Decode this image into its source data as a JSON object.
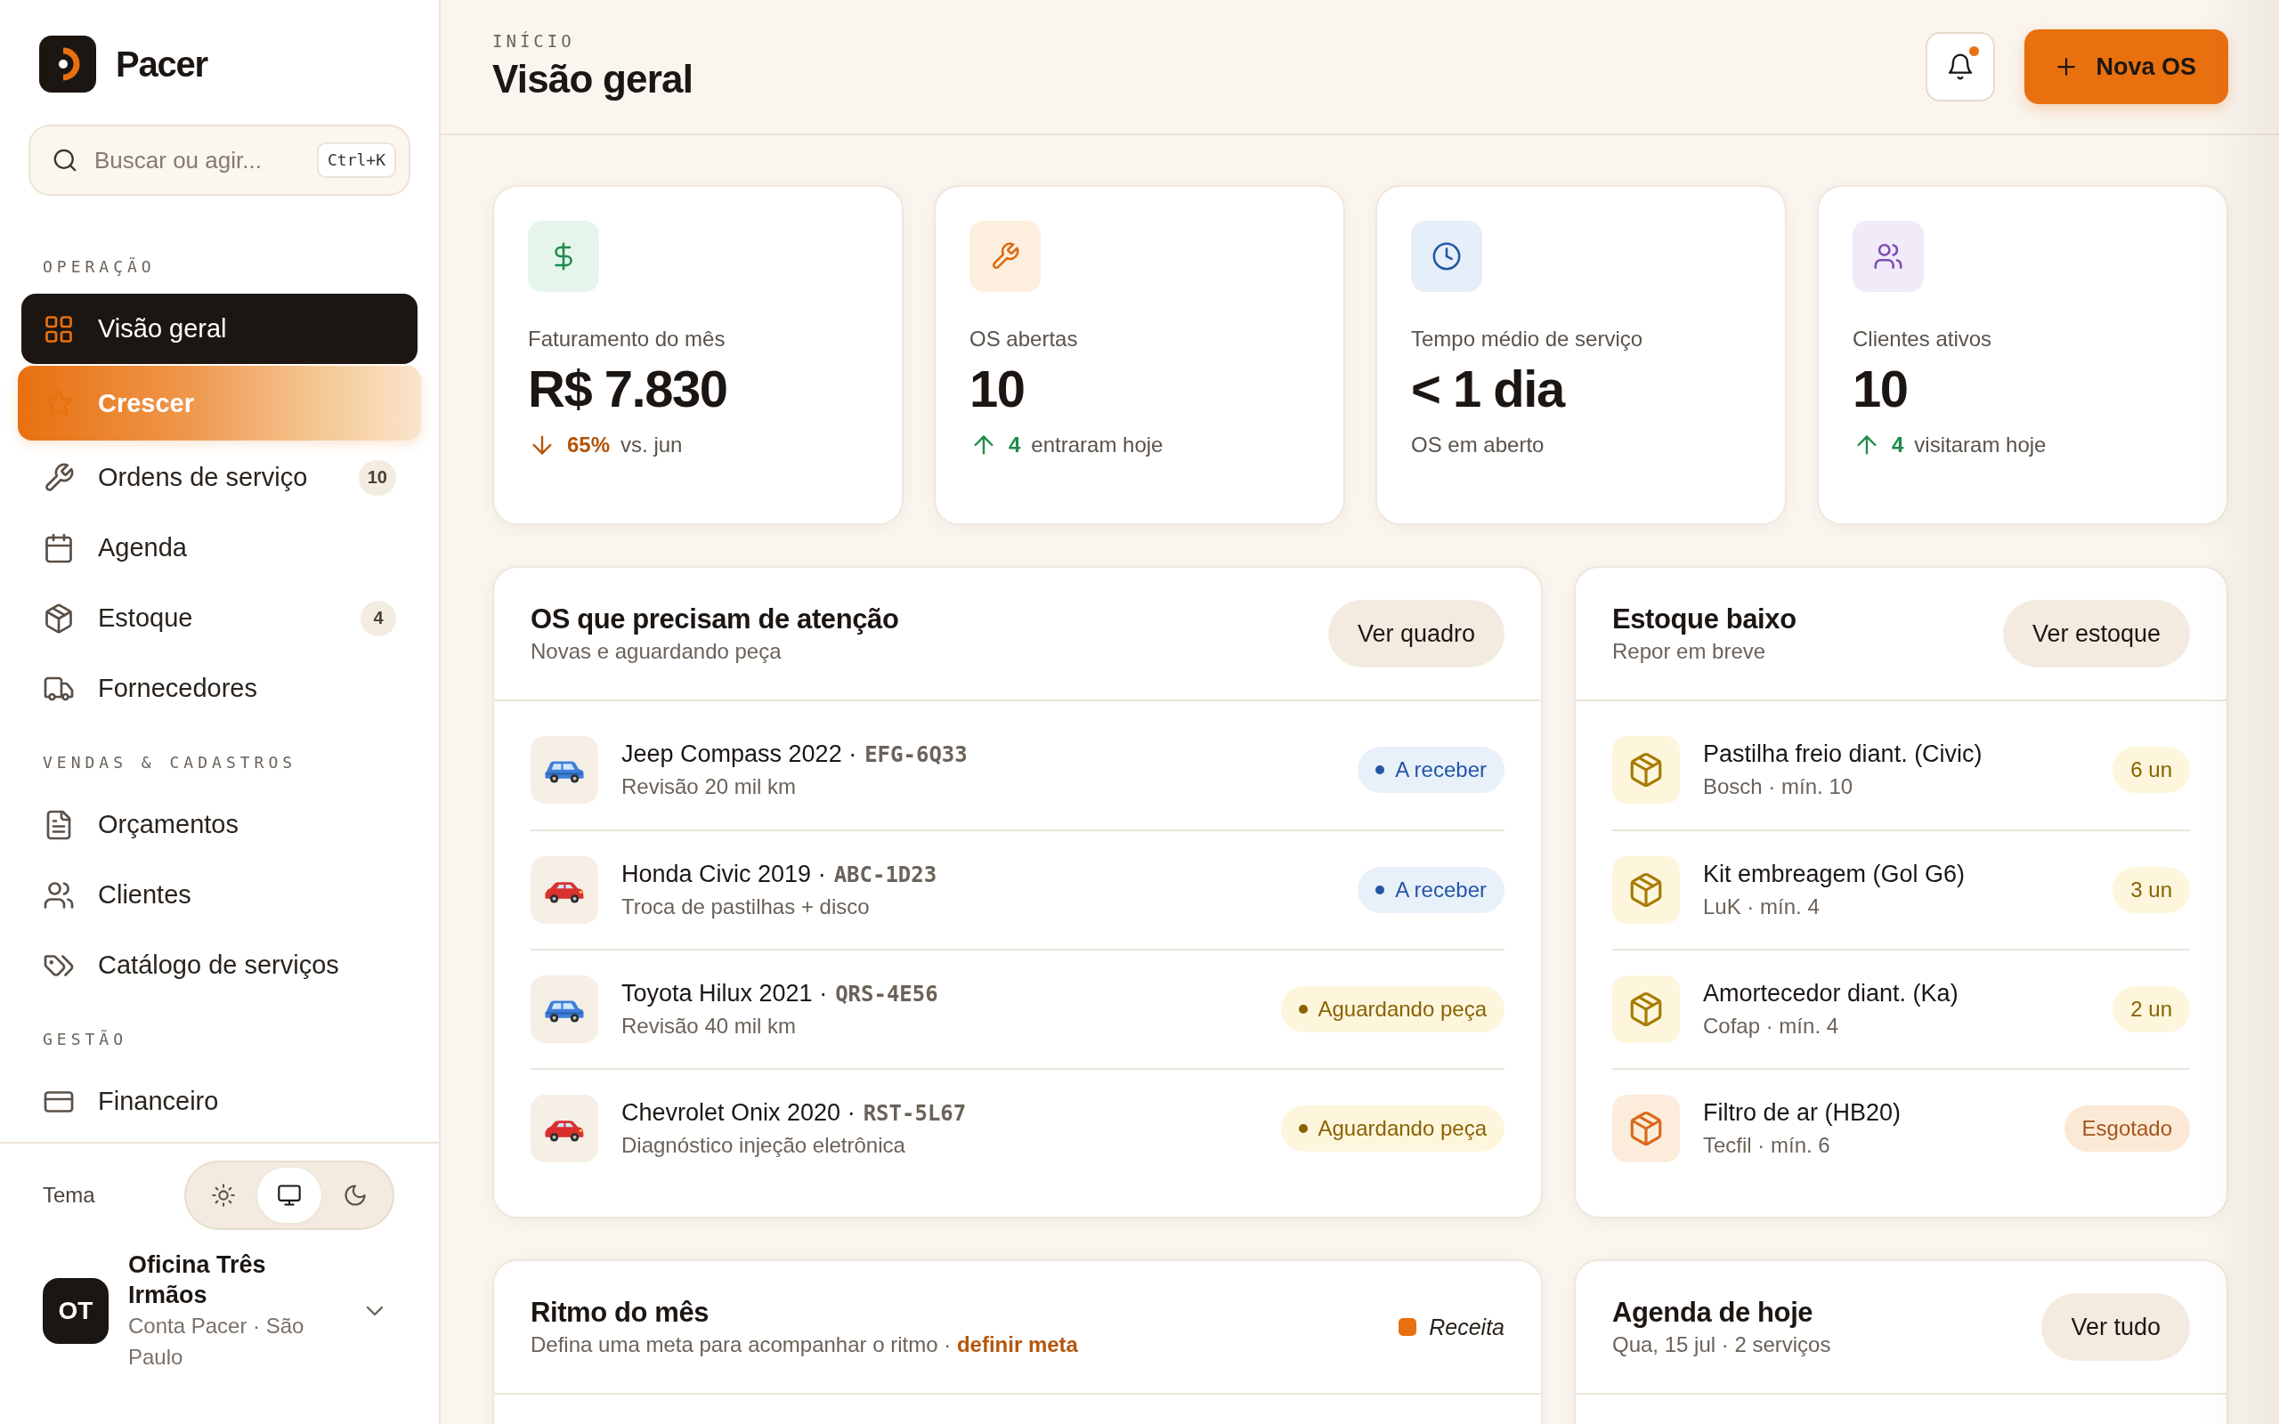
{
  "sidebar": {
    "brand": "Pacer",
    "search": {
      "placeholder": "Buscar ou agir...",
      "shortcut": "Ctrl+K"
    },
    "sections": [
      {
        "title": "OPERAÇÃO",
        "items": [
          {
            "kind": "overview",
            "label": "Visão geral",
            "selected": true,
            "featured": false
          },
          {
            "kind": "growth",
            "label": "Crescer",
            "selected": false,
            "featured": true
          },
          {
            "kind": "orders",
            "label": "Ordens de serviço",
            "selected": false,
            "featured": false,
            "count": "10"
          },
          {
            "kind": "calendar",
            "label": "Agenda",
            "selected": false,
            "featured": false
          },
          {
            "kind": "stock",
            "label": "Estoque",
            "selected": false,
            "featured": false,
            "count": "4"
          },
          {
            "kind": "suppliers",
            "label": "Fornecedores",
            "selected": false,
            "featured": false
          }
        ]
      },
      {
        "title": "VENDAS & CADASTROS",
        "items": [
          {
            "kind": "quotes",
            "label": "Orçamentos",
            "selected": false,
            "featured": false
          },
          {
            "kind": "clients",
            "label": "Clientes",
            "selected": false,
            "featured": false
          },
          {
            "kind": "catalog",
            "label": "Catálogo de serviços",
            "selected": false,
            "featured": false
          }
        ]
      },
      {
        "title": "GESTÃO",
        "items": [
          {
            "kind": "finance",
            "label": "Financeiro",
            "selected": false,
            "featured": false
          }
        ]
      }
    ],
    "theme": {
      "label": "Tema",
      "options": [
        {
          "kind": "light",
          "selected": false
        },
        {
          "kind": "system",
          "selected": true
        },
        {
          "kind": "dark",
          "selected": false
        }
      ]
    },
    "account": {
      "initials": "OT",
      "name": "Oficina Três Irmãos",
      "details": "Conta Pacer · São Paulo"
    }
  },
  "header": {
    "breadcrumb": "INÍCIO",
    "title": "Visão geral",
    "notifications": {
      "unread": true
    },
    "primary_action": "Nova OS"
  },
  "stats": [
    {
      "kind": "revenue",
      "label": "Faturamento do mês",
      "value": "R$ 7.830",
      "footer": {
        "kind": "down",
        "delta": "65%",
        "note": "vs. jun"
      }
    },
    {
      "kind": "orders",
      "label": "OS abertas",
      "value": "10",
      "footer": {
        "kind": "up",
        "delta": "4",
        "note": "entraram hoje"
      }
    },
    {
      "kind": "time",
      "label": "Tempo médio de serviço",
      "value": "< 1 dia",
      "footer": {
        "kind": "plain",
        "note": "OS em aberto"
      }
    },
    {
      "kind": "clients",
      "label": "Clientes ativos",
      "value": "10",
      "footer": {
        "kind": "up",
        "delta": "4",
        "note": "visitaram hoje"
      }
    }
  ],
  "attention": {
    "title": "OS que precisam de atenção",
    "subtitle": "Novas e aguardando peça",
    "action": "Ver quadro",
    "orders": [
      {
        "kind": "suv",
        "title": "Jeep Compass 2022 ·",
        "plate": "EFG-6Q33",
        "service": "Revisão 20 mil km",
        "status": {
          "kind": "incoming",
          "label": "A receber"
        }
      },
      {
        "kind": "sedan",
        "title": "Honda Civic 2019 ·",
        "plate": "ABC-1D23",
        "service": "Troca de pastilhas + disco",
        "status": {
          "kind": "incoming",
          "label": "A receber"
        }
      },
      {
        "kind": "suv",
        "title": "Toyota Hilux 2021 ·",
        "plate": "QRS-4E56",
        "service": "Revisão 40 mil km",
        "status": {
          "kind": "waiting",
          "label": "Aguardando peça"
        }
      },
      {
        "kind": "sedan",
        "title": "Chevrolet Onix 2020 ·",
        "plate": "RST-5L67",
        "service": "Diagnóstico injeção eletrônica",
        "status": {
          "kind": "waiting",
          "label": "Aguardando peça"
        }
      }
    ]
  },
  "low_stock": {
    "title": "Estoque baixo",
    "subtitle": "Repor em breve",
    "action": "Ver estoque",
    "items": [
      {
        "kind": "low",
        "name": "Pastilha freio diant. (Civic)",
        "details": "Bosch · mín. 10",
        "quantity": "6 un"
      },
      {
        "kind": "low",
        "name": "Kit embreagem (Gol G6)",
        "details": "LuK · mín. 4",
        "quantity": "3 un"
      },
      {
        "kind": "low",
        "name": "Amortecedor diant. (Ka)",
        "details": "Cofap · mín. 4",
        "quantity": "2 un"
      },
      {
        "kind": "out",
        "name": "Filtro de ar (HB20)",
        "details": "Tecfil · mín. 6",
        "quantity": "Esgotado"
      }
    ]
  },
  "rhythm": {
    "title": "Ritmo do mês",
    "subtitle": "Defina uma meta para acompanhar o ritmo ·",
    "link": "definir meta",
    "legend": [
      {
        "label": "Receita",
        "color": "#e8700f"
      }
    ]
  },
  "agenda": {
    "title": "Agenda de hoje",
    "subtitle": "Qua, 15 jul · 2 serviços",
    "action": "Ver tudo"
  }
}
